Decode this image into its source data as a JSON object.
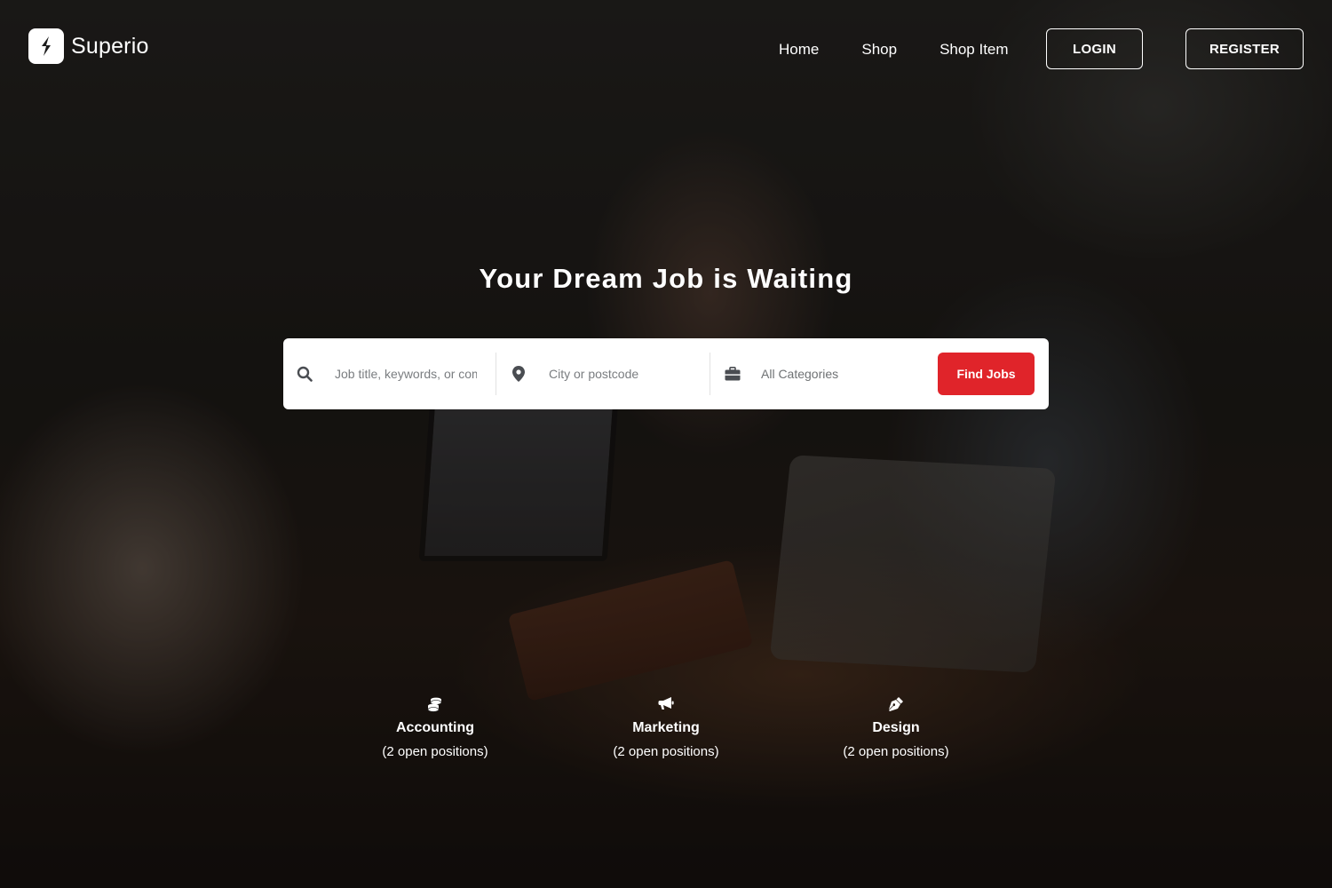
{
  "brand": {
    "name": "Superio",
    "accent_color": "#e0242a"
  },
  "nav": {
    "items": [
      {
        "label": "Home"
      },
      {
        "label": "Shop"
      },
      {
        "label": "Shop Item"
      }
    ],
    "login_label": "LOGIN",
    "register_label": "REGISTER"
  },
  "hero": {
    "title": "Your Dream Job is Waiting"
  },
  "search": {
    "keyword_placeholder": "Job title, keywords, or company",
    "location_placeholder": "City or postcode",
    "category_value": "All Categories",
    "button_label": "Find Jobs",
    "icons": [
      "search-icon",
      "map-pin-icon",
      "briefcase-icon"
    ]
  },
  "categories": [
    {
      "name": "Accounting",
      "count": "(2 open positions)",
      "icon": "coins-icon"
    },
    {
      "name": "Marketing",
      "count": "(2 open positions)",
      "icon": "megaphone-icon"
    },
    {
      "name": "Design",
      "count": "(2 open positions)",
      "icon": "pen-nib-icon"
    }
  ]
}
